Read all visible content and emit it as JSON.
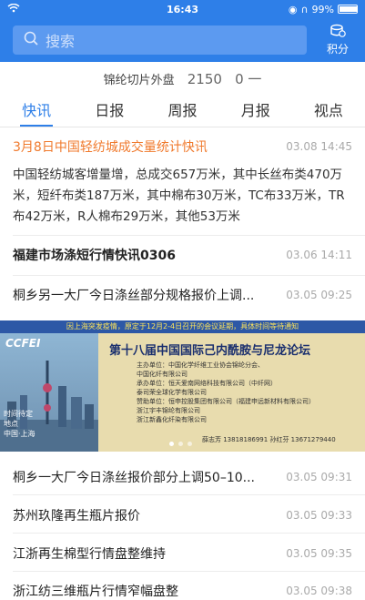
{
  "status": {
    "time": "16:43",
    "battery": "99%",
    "battery_level": 0.99
  },
  "header": {
    "search_placeholder": "搜索",
    "points_label": "积分"
  },
  "ticker": {
    "name": "锦纶切片外盘",
    "price": "2150",
    "change": "0 一"
  },
  "tabs": [
    {
      "label": "快讯"
    },
    {
      "label": "日报"
    },
    {
      "label": "周报"
    },
    {
      "label": "月报"
    },
    {
      "label": "视点"
    }
  ],
  "news": [
    {
      "title": "3月8日中国轻纺城成交量统计快讯",
      "date": "03.08 14:45",
      "body": "中国轻纺城客增量增，总成交657万米，其中长丝布类470万米，短纤布类187万米，其中棉布30万米，TC布33万米，TR布42万米，R人棉布29万米，其他53万米"
    },
    {
      "title": "福建市场涤短行情快讯0306",
      "date": "03.06 14:11"
    },
    {
      "title": "桐乡另一大厂今日涤丝部分规格报价上调...",
      "date": "03.05 09:25"
    },
    {
      "title": "桐乡一大厂今日涤丝报价部分上调50–10...",
      "date": "03.05 09:31"
    },
    {
      "title": "苏州玖隆再生瓶片报价",
      "date": "03.05 09:33"
    },
    {
      "title": "江浙再生棉型行情盘整维持",
      "date": "03.05 09:35"
    },
    {
      "title": "浙江纺三维瓶片行情窄幅盘整",
      "date": "03.05 09:38"
    }
  ],
  "banner": {
    "notice": "因上海突发疫情，原定于12月2-4日召开的会议延期，具体时间等待通知",
    "logo": "CCFEI",
    "title": "第十八届中国国际己内酰胺与尼龙论坛",
    "lines": [
      "主办单位：中国化学纤维工业协会锦纶分会、",
      "中国化纤有限公司",
      "承办单位：恒天爱南网络科技有限公司（中纤网）",
      "泰司荣全球化学有限公司",
      "赞助单位：恒申控股集团有限公司（福建申远新材料有限公司）",
      "浙江宇丰锦纶有限公司",
      "浙江新鑫化纤染有限公司"
    ],
    "time_label": "时间待定",
    "place_label": "地点",
    "place": "中国·上海",
    "contact": "薛志芳 13818186991  孙红芬 13671279440"
  }
}
